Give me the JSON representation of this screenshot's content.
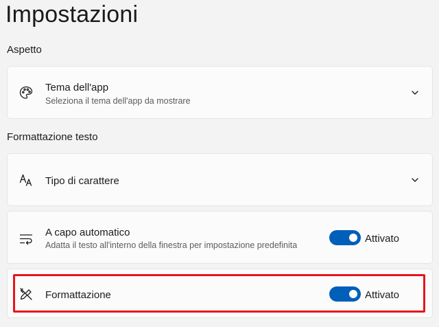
{
  "page": {
    "title": "Impostazioni"
  },
  "sections": {
    "appearance": "Aspetto",
    "text_formatting": "Formattazione testo"
  },
  "theme": {
    "title": "Tema dell'app",
    "description": "Seleziona il tema dell'app da mostrare",
    "icon": "palette-icon"
  },
  "font": {
    "title": "Tipo di carattere",
    "icon": "font-icon"
  },
  "wrap": {
    "title": "A capo automatico",
    "description": "Adatta il testo all'interno della finestra per impostazione predefinita",
    "icon": "text-wrap-icon",
    "state": "Attivato",
    "on": true
  },
  "formatting": {
    "title": "Formattazione",
    "icon": "formatting-icon",
    "state": "Attivato",
    "on": true
  },
  "colors": {
    "accent": "#005fb8",
    "highlight": "#e8141c"
  }
}
